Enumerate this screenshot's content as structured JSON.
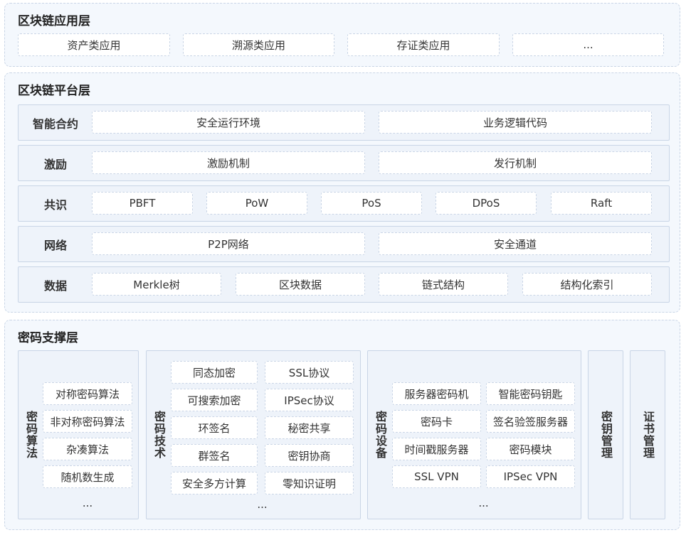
{
  "app_layer": {
    "title": "区块链应用层",
    "items": [
      "资产类应用",
      "溯源类应用",
      "存证类应用",
      "..."
    ]
  },
  "platform_layer": {
    "title": "区块链平台层",
    "rows": [
      {
        "label": "智能合约",
        "items": [
          "安全运行环境",
          "业务逻辑代码"
        ]
      },
      {
        "label": "激励",
        "items": [
          "激励机制",
          "发行机制"
        ]
      },
      {
        "label": "共识",
        "items": [
          "PBFT",
          "PoW",
          "PoS",
          "DPoS",
          "Raft"
        ]
      },
      {
        "label": "网络",
        "items": [
          "P2P网络",
          "安全通道"
        ]
      },
      {
        "label": "数据",
        "items": [
          "Merkle树",
          "区块数据",
          "链式结构",
          "结构化索引"
        ]
      }
    ]
  },
  "crypto_layer": {
    "title": "密码支撑层",
    "algorithms": {
      "label": "密码算法",
      "items": [
        "对称密码算法",
        "非对称密码算法",
        "杂凑算法",
        "随机数生成"
      ],
      "more": "..."
    },
    "techniques": {
      "label": "密码技术",
      "items": [
        "同态加密",
        "SSL协议",
        "可搜索加密",
        "IPSec协议",
        "环签名",
        "秘密共享",
        "群签名",
        "密钥协商",
        "安全多方计算",
        "零知识证明"
      ],
      "more": "..."
    },
    "devices": {
      "label": "密码设备",
      "items": [
        "服务器密码机",
        "智能密码钥匙",
        "密码卡",
        "签名验签服务器",
        "时间戳服务器",
        "密码模块",
        "SSL VPN",
        "IPSec VPN"
      ],
      "more": "..."
    },
    "key_management": {
      "label": "密钥管理"
    },
    "cert_management": {
      "label": "证书管理"
    }
  }
}
